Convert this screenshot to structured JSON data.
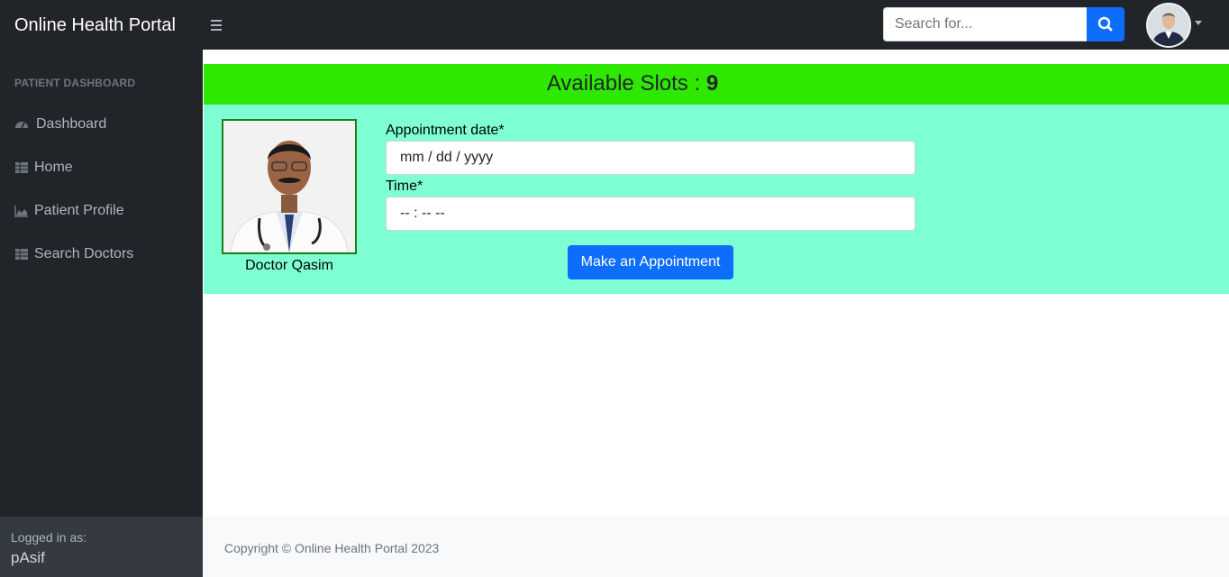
{
  "navbar": {
    "brand": "Online Health Portal",
    "search_placeholder": "Search for...",
    "search_icon": "search-icon",
    "toggle_icon": "hamburger-icon"
  },
  "sidebar": {
    "heading": "PATIENT DASHBOARD",
    "items": [
      {
        "label": "Dashboard",
        "icon": "gauge-icon"
      },
      {
        "label": "Home",
        "icon": "table-icon"
      },
      {
        "label": "Patient Profile",
        "icon": "area-chart-icon"
      },
      {
        "label": "Search Doctors",
        "icon": "table-icon"
      }
    ],
    "footer": {
      "logged_in_label": "Logged in as:",
      "username": "pAsif"
    }
  },
  "main": {
    "slots_label": "Available Slots :",
    "slots_count": "9",
    "doctor_name": "Doctor Qasim",
    "date_label": "Appointment date*",
    "date_value": "mm / dd / yyyy",
    "time_label": "Time*",
    "time_value": "-- : --  --",
    "submit_label": "Make an Appointment"
  },
  "footer": {
    "copyright": "Copyright © Online Health Portal 2023"
  },
  "colors": {
    "navbar_bg": "#212529",
    "slots_bar": "#2ee800",
    "panel_bg": "#7fffd4",
    "primary": "#0d6efd"
  }
}
